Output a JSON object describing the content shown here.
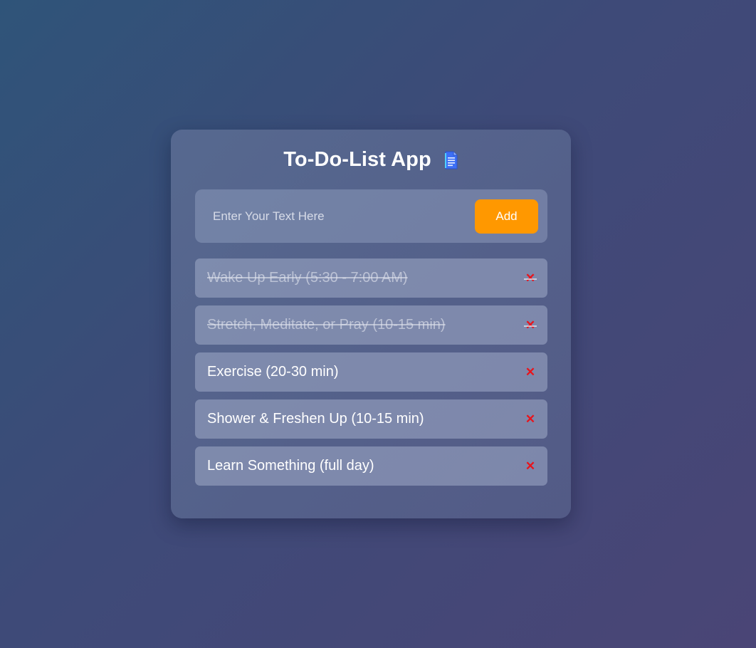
{
  "app": {
    "title": "To-Do-List App",
    "title_icon": "document-icon"
  },
  "input": {
    "placeholder": "Enter Your Text Here",
    "value": "",
    "add_label": "Add"
  },
  "tasks": [
    {
      "text": "Wake Up Early (5:30 - 7:00 AM)",
      "done": true,
      "delete_glyph": "✕"
    },
    {
      "text": "Stretch, Meditate, or Pray (10-15 min)",
      "done": true,
      "delete_glyph": "✕"
    },
    {
      "text": "Exercise (20-30 min)",
      "done": false,
      "delete_glyph": "✕"
    },
    {
      "text": "Shower & Freshen Up (10-15 min)",
      "done": false,
      "delete_glyph": "✕"
    },
    {
      "text": "Learn Something (full day)",
      "done": false,
      "delete_glyph": "✕"
    }
  ],
  "colors": {
    "accent": "#ff9800",
    "delete": "#e8141c"
  }
}
